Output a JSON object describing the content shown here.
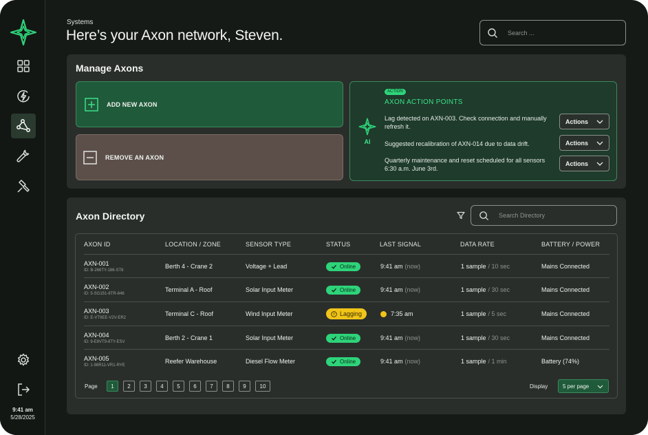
{
  "sidebar": {
    "time": "9:41 am",
    "date": "5/28/2025"
  },
  "header": {
    "breadcrumb": "Systems",
    "title": "Here’s your Axon network, Steven.",
    "search_placeholder": "Search ..."
  },
  "manage": {
    "title": "Manage Axons",
    "add_label": "ADD NEW AXON",
    "remove_label": "REMOVE AN AXON",
    "ai": {
      "badge": "ACTION",
      "heading": "AXON ACTION POINTS",
      "ai_label": "AI",
      "items": [
        {
          "text": "Lag detected on AXN-003. Check connection and manually refresh it.",
          "button": "Actions"
        },
        {
          "text": "Suggested recalibration of AXN-014 due to data drift.",
          "button": "Actions"
        },
        {
          "text": "Quarterly maintenance and reset scheduled for all sensors 6:30 a.m. June 3rd.",
          "button": "Actions"
        }
      ]
    }
  },
  "directory": {
    "title": "Axon Directory",
    "search_placeholder": "Search Directory",
    "columns": [
      "AXON ID",
      "LOCATION / ZONE",
      "SENSOR TYPE",
      "STATUS",
      "LAST SIGNAL",
      "DATA RATE",
      "BATTERY / POWER"
    ],
    "rows": [
      {
        "id": "AXN-001",
        "sub": "ID: B-266TY-186-ST8",
        "location": "Berth 4 - Crane 2",
        "sensor": "Voltage + Lead",
        "status": "Online",
        "signal": "9:41 am",
        "signal_note": "(now)",
        "rate": "1 sample",
        "rate_note": "/ 10 sec",
        "power": "Mains Connected"
      },
      {
        "id": "AXN-002",
        "sub": "ID: 5-SG151-6TR-846",
        "location": "Terminal A - Roof",
        "sensor": "Solar Input Meter",
        "status": "Online",
        "signal": "9:41 am",
        "signal_note": "(now)",
        "rate": "1 sample",
        "rate_note": "/ 30 sec",
        "power": "Mains Connected"
      },
      {
        "id": "AXN-003",
        "sub": "ID: E-VT9EE-V2V-ER2",
        "location": "Terminal C - Roof",
        "sensor": "Wind Input Meter",
        "status": "Lagging",
        "signal": "7:35 am",
        "signal_note": "",
        "rate": "1 sample",
        "rate_note": "/ 5 sec",
        "power": "Mains Connected"
      },
      {
        "id": "AXN-004",
        "sub": "ID: 9-E8VT9-8TY-ESV",
        "location": "Berth 2 - Crane 1",
        "sensor": "Solar Input Meter",
        "status": "Online",
        "signal": "9:41 am",
        "signal_note": "(now)",
        "rate": "1 sample",
        "rate_note": "/ 30 sec",
        "power": "Mains Connected"
      },
      {
        "id": "AXN-005",
        "sub": "ID: 1-98R11-VR1-RYE",
        "location": "Reefer Warehouse",
        "sensor": "Diesel Flow Meter",
        "status": "Online",
        "signal": "9:41 am",
        "signal_note": "(now)",
        "rate": "1 sample",
        "rate_note": "/ 1 min",
        "power": "Battery (74%)"
      }
    ],
    "pager": {
      "label": "Page",
      "pages": [
        "1",
        "2",
        "3",
        "4",
        "5",
        "6",
        "7",
        "8",
        "9",
        "10"
      ],
      "current": "1",
      "display_label": "Display",
      "per_page": "5 per page"
    }
  },
  "colors": {
    "accent": "#2ed47a",
    "warning": "#f0c419",
    "background": "#161a17",
    "panel": "#2a2e2b"
  }
}
